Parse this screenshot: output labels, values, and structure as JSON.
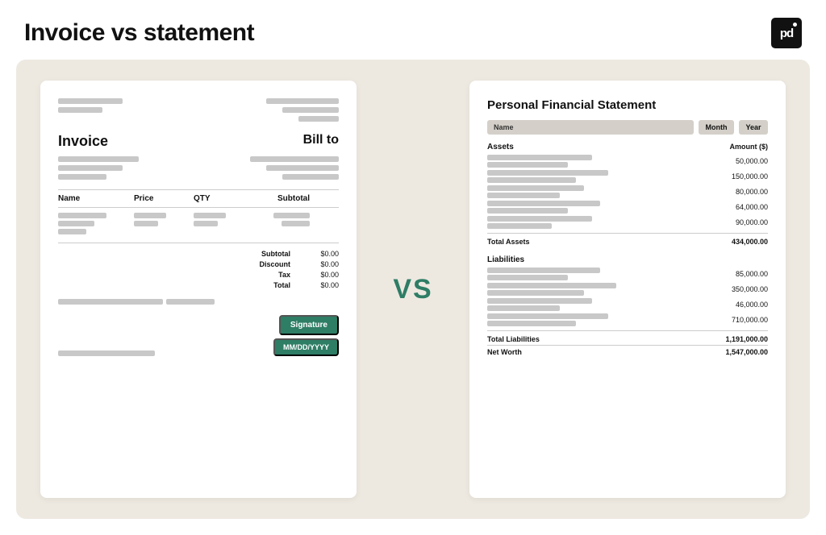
{
  "header": {
    "title": "Invoice vs statement",
    "logo_text": "pd"
  },
  "vs_label": "VS",
  "invoice": {
    "label": "Invoice",
    "bill_to": "Bill to",
    "table": {
      "headers": [
        "Name",
        "Price",
        "QTY",
        "Subtotal"
      ],
      "totals": [
        {
          "label": "Subtotal",
          "value": "$0.00"
        },
        {
          "label": "Discount",
          "value": "$0.00"
        },
        {
          "label": "Tax",
          "value": "$0.00"
        },
        {
          "label": "Total",
          "value": "$0.00"
        }
      ]
    },
    "signature_btn": "Signature",
    "date_btn": "MM/DD/YYYY"
  },
  "statement": {
    "title": "Personal Financial Statement",
    "name_label": "Name",
    "month_label": "Month",
    "year_label": "Year",
    "assets_section": {
      "title": "Assets",
      "amount_header": "Amount ($)",
      "rows": [
        {
          "value": "50,000.00"
        },
        {
          "value": "150,000.00"
        },
        {
          "value": "80,000.00"
        },
        {
          "value": "64,000.00"
        },
        {
          "value": "90,000.00"
        }
      ],
      "total_label": "Total Assets",
      "total_value": "434,000.00"
    },
    "liabilities_section": {
      "title": "Liabilities",
      "rows": [
        {
          "value": "85,000.00"
        },
        {
          "value": "350,000.00"
        },
        {
          "value": "46,000.00"
        },
        {
          "value": "710,000.00"
        }
      ],
      "total_label": "Total Liabilities",
      "total_value": "1,191,000.00",
      "net_worth_label": "Net Worth",
      "net_worth_value": "1,547,000.00"
    }
  }
}
